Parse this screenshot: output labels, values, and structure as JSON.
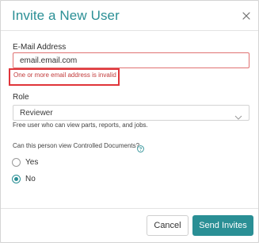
{
  "dialog": {
    "title": "Invite a New User"
  },
  "email": {
    "label": "E-Mail Address",
    "value": "email.email.com",
    "error": "One or more email address is invalid"
  },
  "role": {
    "label": "Role",
    "selected": "Reviewer",
    "help": "Free user who can view parts, reports, and jobs."
  },
  "controlled_documents": {
    "question": "Can this person view Controlled Documents?",
    "options": [
      {
        "label": "Yes",
        "checked": false
      },
      {
        "label": "No",
        "checked": true
      }
    ]
  },
  "footer": {
    "cancel_label": "Cancel",
    "send_label": "Send Invites"
  },
  "colors": {
    "accent": "#2a8f95",
    "error": "#e0353a"
  },
  "icons": {
    "close": "close-icon",
    "role_dropdown": "chevron-down-icon",
    "help": "help-circle-icon"
  }
}
